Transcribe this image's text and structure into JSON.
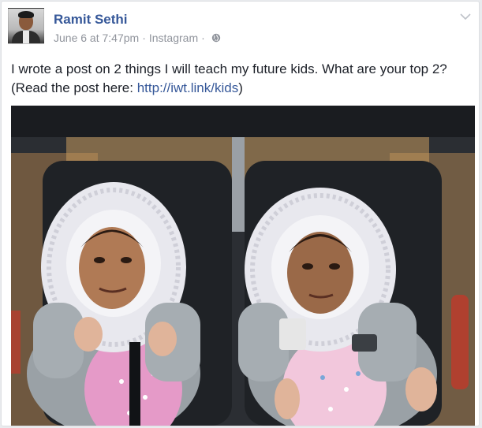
{
  "post": {
    "author": "Ramit Sethi",
    "date": "June 6 at 7:47pm",
    "source": "Instagram",
    "separator": "·",
    "privacy_icon": "globe-icon",
    "menu_icon": "chevron-down-icon",
    "text_line1": "I wrote a post on 2 things I will teach my future kids. What are your top 2?",
    "text_line2_prefix": "(Read the post here: ",
    "link_text": "http://iwt.link/kids",
    "text_line2_suffix": ")"
  },
  "colors": {
    "author": "#365899",
    "link": "#365899",
    "meta": "#90949c",
    "text": "#1d2129"
  }
}
